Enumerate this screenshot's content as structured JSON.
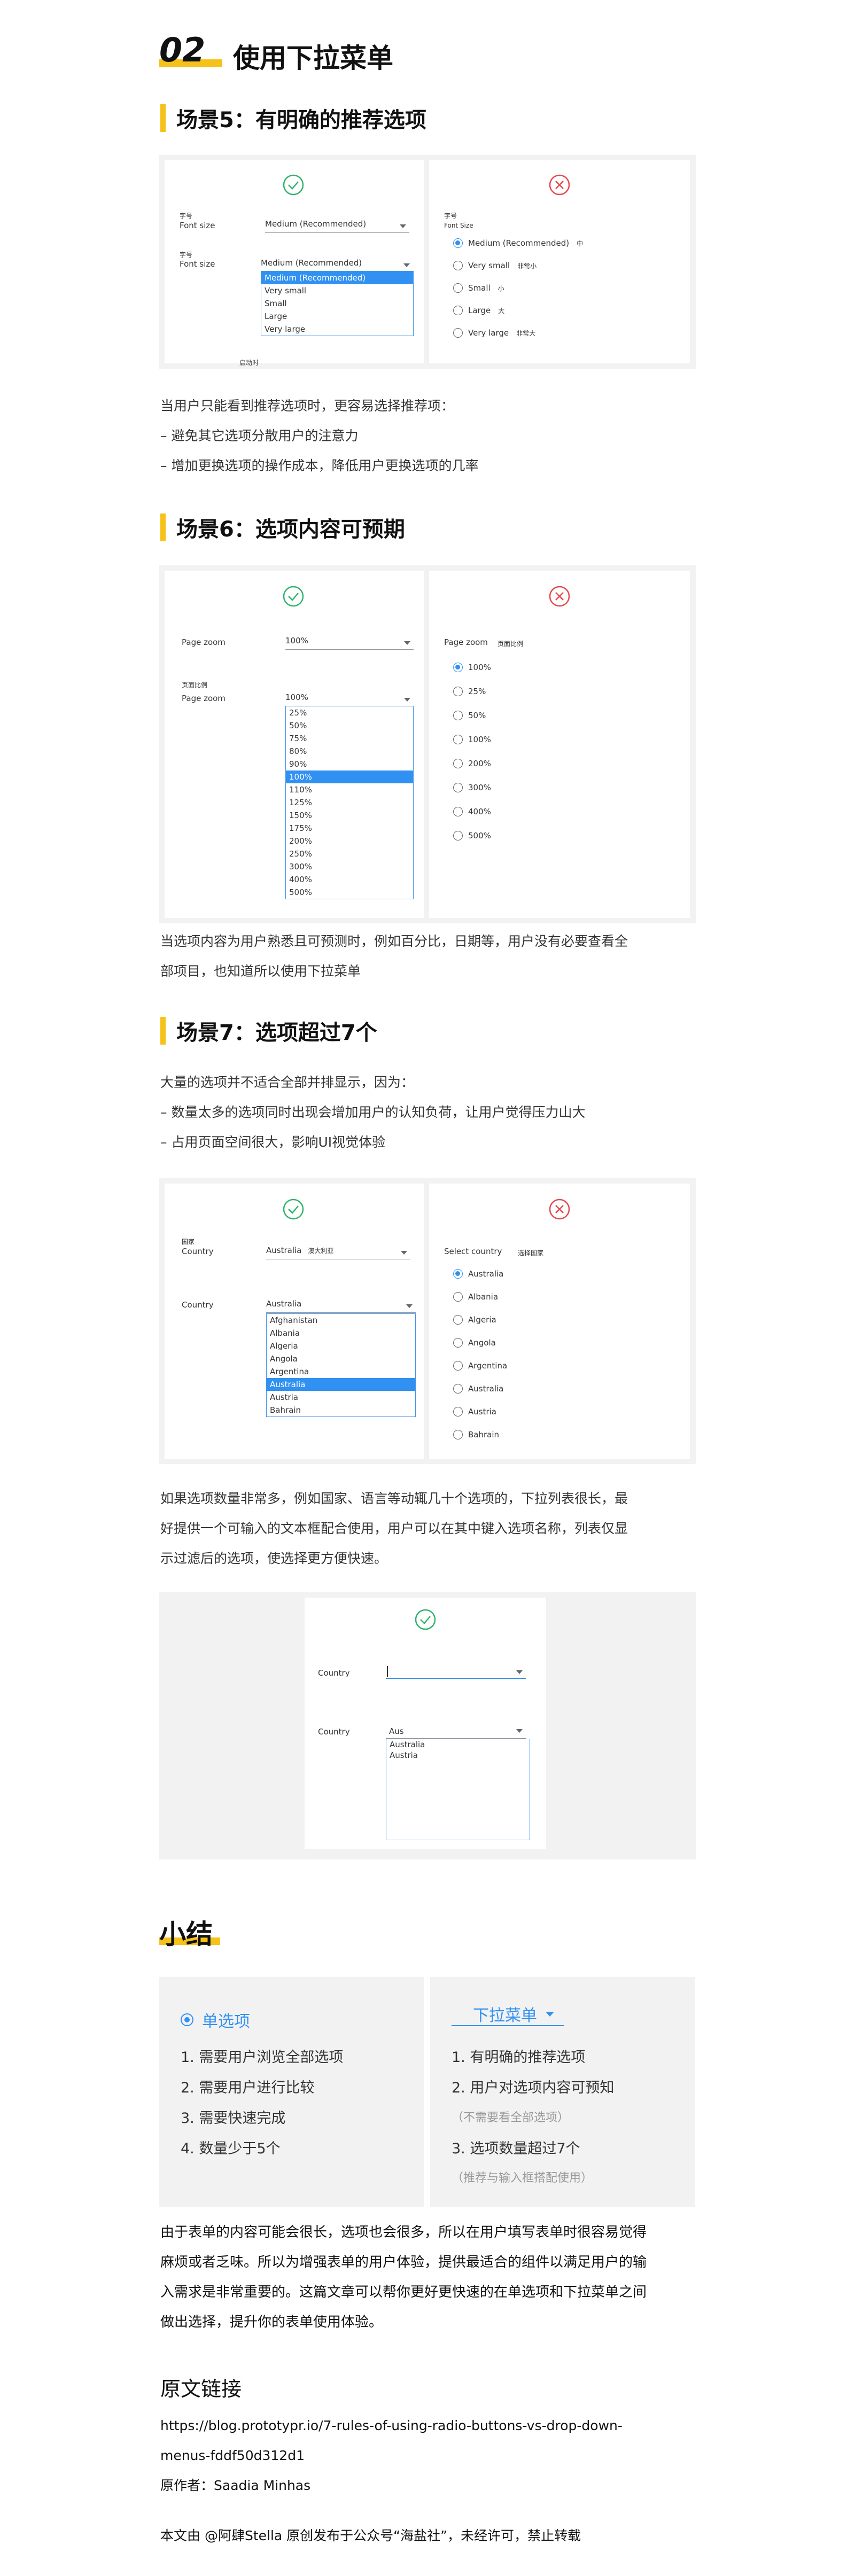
{
  "header": {
    "number": "02",
    "title": "使用下拉菜单"
  },
  "s5": {
    "title": "场景5：有明确的推荐选项",
    "left": {
      "label_cn": "字号",
      "label_en": "Font size",
      "selected": "Medium (Recommended)",
      "label2_cn": "字号",
      "label2_en": "Font size",
      "options": [
        "Medium (Recommended)",
        "Very small",
        "Small",
        "Large",
        "Very large"
      ],
      "bottom_cn": "启动时"
    },
    "right": {
      "label_cn": "字号",
      "label_en": "Font Size",
      "radios": [
        {
          "en": "Medium (Recommended)",
          "cn": "中"
        },
        {
          "en": "Very small",
          "cn": "非常小"
        },
        {
          "en": "Small",
          "cn": "小"
        },
        {
          "en": "Large",
          "cn": "大"
        },
        {
          "en": "Very large",
          "cn": "非常大"
        }
      ]
    },
    "text": [
      "当用户只能看到推荐选项时，更容易选择推荐项：",
      "– 避免其它选项分散用户的注意力",
      "– 增加更换选项的操作成本，降低用户更换选项的几率"
    ]
  },
  "s6": {
    "title": "场景6：选项内容可预期",
    "left": {
      "label": "Page zoom",
      "selected": "100%",
      "label2_cn": "页面比例",
      "label2_en": "Page zoom",
      "selected2": "100%",
      "options": [
        "25%",
        "50%",
        "75%",
        "80%",
        "90%",
        "100%",
        "110%",
        "125%",
        "150%",
        "175%",
        "200%",
        "250%",
        "300%",
        "400%",
        "500%"
      ]
    },
    "right": {
      "label_en": "Page zoom",
      "label_cn": "页面比例",
      "radios": [
        "100%",
        "25%",
        "50%",
        "100%",
        "200%",
        "300%",
        "400%",
        "500%"
      ]
    },
    "text": [
      "当选项内容为用户熟悉且可预测时，例如百分比，日期等，用户没有必要查看全",
      "部项目，也知道所以使用下拉菜单"
    ]
  },
  "s7": {
    "title": "场景7：选项超过7个",
    "intro": [
      "大量的选项并不适合全部并排显示，因为：",
      "– 数量太多的选项同时出现会增加用户的认知负荷，让用户觉得压力山大",
      "– 占用页面空间很大，影响UI视觉体验"
    ],
    "left": {
      "label_cn": "国家",
      "label_en": "Country",
      "selected": "Australia",
      "selected_cn": "澳大利亚",
      "label2": "Country",
      "selected2": "Australia",
      "options": [
        "Afghanistan",
        "Albania",
        "Algeria",
        "Angola",
        "Argentina",
        "Australia",
        "Austria",
        "Bahrain"
      ]
    },
    "right": {
      "label_en": "Select country",
      "label_cn": "选择国家",
      "radios": [
        "Australia",
        "Albania",
        "Algeria",
        "Angola",
        "Argentina",
        "Australia",
        "Austria",
        "Bahrain"
      ]
    },
    "text": [
      "如果选项数量非常多，例如国家、语言等动辄几十个选项的，下拉列表很长，最",
      "好提供一个可输入的文本框配合使用，用户可以在其中键入选项名称，列表仅显",
      "示过滤后的选项，使选择更方便快速。"
    ],
    "combo": {
      "label1": "Country",
      "label2": "Country",
      "typed": "Aus",
      "results": [
        "Australia",
        "Austria"
      ]
    }
  },
  "summary": {
    "title": "小结",
    "left": {
      "header": "单选项",
      "items": [
        "1. 需要用户浏览全部选项",
        "2. 需要用户进行比较",
        "3. 需要快速完成",
        "4. 数量少于5个"
      ]
    },
    "right": {
      "header": "下拉菜单",
      "items": [
        "1. 有明确的推荐选项",
        "2. 用户对选项内容可预知",
        "（不需要看全部选项）",
        "3. 选项数量超过7个",
        "（推荐与输入框搭配使用）"
      ]
    }
  },
  "conclusion": [
    "由于表单的内容可能会很长，选项也会很多，所以在用户填写表单时很容易觉得",
    "麻烦或者乏味。所以为增强表单的用户体验，提供最适合的组件以满足用户的输",
    "入需求是非常重要的。这篇文章可以帮你更好更快速的在单选项和下拉菜单之间",
    "做出选择，提升你的表单使用体验。"
  ],
  "source": {
    "title": "原文链接",
    "url_line1": "https://blog.prototypr.io/7-rules-of-using-radio-buttons-vs-drop-down-",
    "url_line2": "menus-fddf50d312d1",
    "author": "原作者：Saadia Minhas"
  },
  "footer": "本文由 @阿肆Stella 原创发布于公众号“海盐社”，未经许可，禁止转载",
  "colors": {
    "accent": "#f6c21a",
    "blue": "#3191f2",
    "green": "#2fb36b",
    "red": "#e5484d",
    "panel": "#f2f2f2"
  }
}
